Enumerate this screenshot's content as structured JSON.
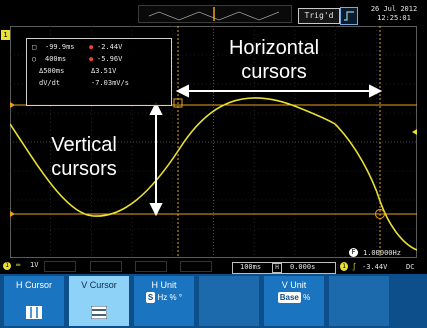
{
  "top_bar": {
    "trigger_status": "Trig'd",
    "date": "26 Jul 2012",
    "time": "12:25:01"
  },
  "cursor_readout": {
    "h1": "-99.9ms",
    "h1_v": "-2.44V",
    "h2": "400ms",
    "h2_v": "-5.96V",
    "delta_t": "Δ500ms",
    "delta_v": "Δ3.51V",
    "dvdt_label": "dV/dt",
    "dvdt_value": "-7.03mV/s"
  },
  "annotations": {
    "horizontal_line1": "Horizontal",
    "horizontal_line2": "cursors",
    "vertical_line1": "Vertical",
    "vertical_line2": "cursors"
  },
  "channel": {
    "marker": "1",
    "scale": "1V",
    "color": "#e8e034"
  },
  "status_bar": {
    "timebase": "100ms",
    "position": "0.000s",
    "frequency": "1.00000Hz",
    "trigger_channel": "1",
    "trigger_level": "-3.44V",
    "coupling": "DC"
  },
  "menu": {
    "h_cursor": "H Cursor",
    "v_cursor": "V Cursor",
    "h_unit": "H Unit",
    "h_unit_opts": [
      "S",
      "Hz",
      "%",
      "°"
    ],
    "v_unit": "V Unit",
    "v_unit_opts": [
      "Base",
      "%"
    ]
  },
  "colors": {
    "trace": "#e8e034",
    "menu_bg": "#0d4f8a",
    "softkey": "#1a74c0",
    "softkey_active": "#8fd2f7",
    "marker": "#e8a21c"
  }
}
